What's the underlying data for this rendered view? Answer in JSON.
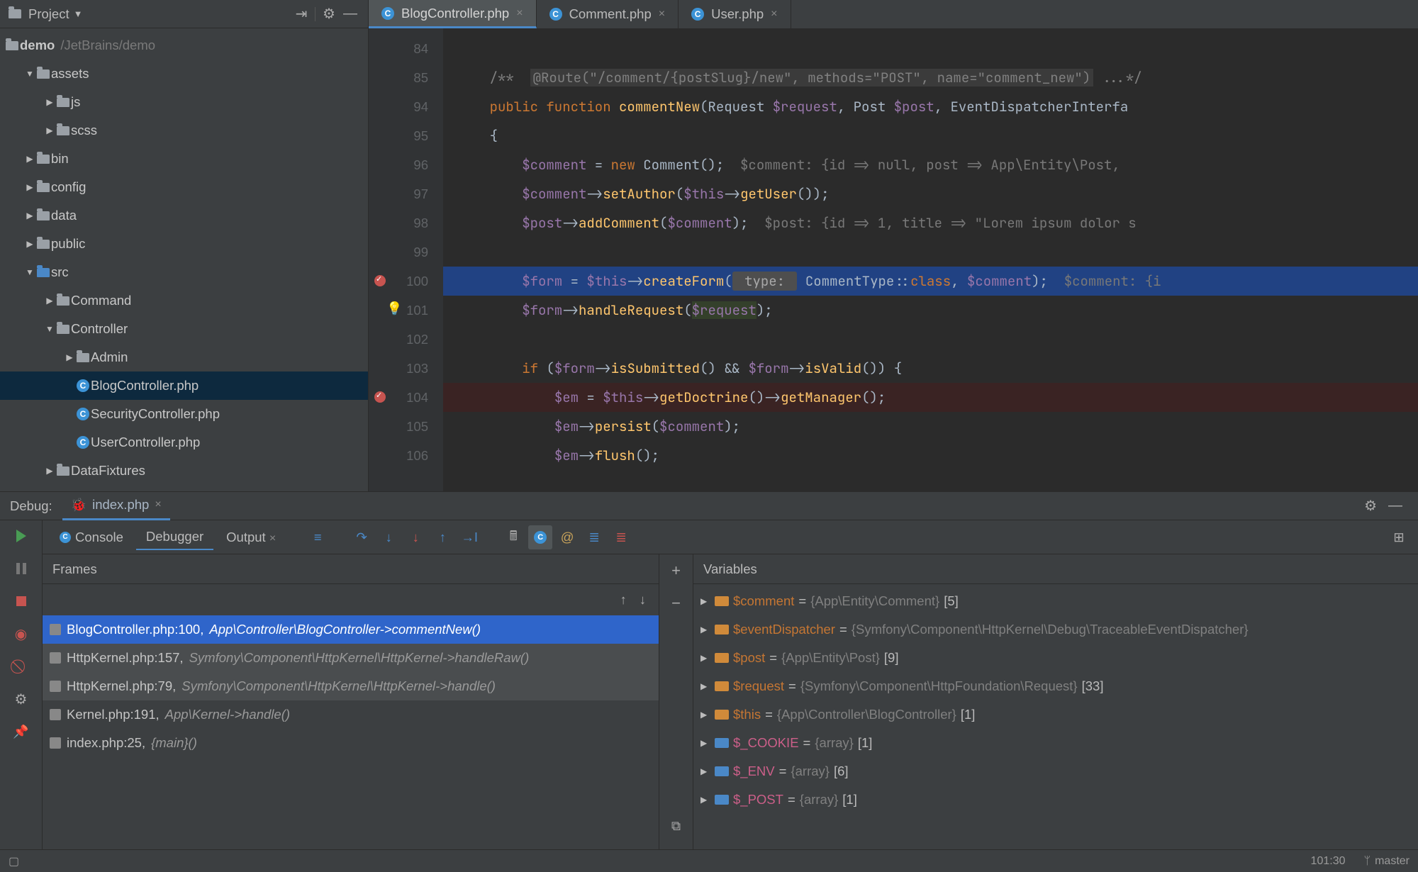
{
  "sidebar": {
    "header": {
      "label": "Project"
    },
    "root": {
      "name": "demo",
      "path": "/JetBrains/demo"
    },
    "items": [
      {
        "label": "assets",
        "kind": "folder",
        "indent": 1,
        "open": true
      },
      {
        "label": "js",
        "kind": "folder",
        "indent": 2
      },
      {
        "label": "scss",
        "kind": "folder",
        "indent": 2
      },
      {
        "label": "bin",
        "kind": "folder",
        "indent": 1
      },
      {
        "label": "config",
        "kind": "folder",
        "indent": 1
      },
      {
        "label": "data",
        "kind": "folder",
        "indent": 1
      },
      {
        "label": "public",
        "kind": "folder",
        "indent": 1
      },
      {
        "label": "src",
        "kind": "folder-blue",
        "indent": 1,
        "open": true
      },
      {
        "label": "Command",
        "kind": "folder",
        "indent": 2
      },
      {
        "label": "Controller",
        "kind": "folder",
        "indent": 2,
        "open": true
      },
      {
        "label": "Admin",
        "kind": "folder",
        "indent": 3
      },
      {
        "label": "BlogController.php",
        "kind": "php",
        "indent": 3,
        "selected": true
      },
      {
        "label": "SecurityController.php",
        "kind": "php",
        "indent": 3
      },
      {
        "label": "UserController.php",
        "kind": "php",
        "indent": 3
      },
      {
        "label": "DataFixtures",
        "kind": "folder",
        "indent": 2
      }
    ]
  },
  "tabs": [
    {
      "label": "BlogController.php",
      "active": true
    },
    {
      "label": "Comment.php"
    },
    {
      "label": "User.php"
    }
  ],
  "editor": {
    "gutter": [
      "84",
      "85",
      "94",
      "95",
      "96",
      "97",
      "98",
      "99",
      "100",
      "101",
      "102",
      "103",
      "104",
      "105",
      "106"
    ],
    "breakpoints": {
      "100": true,
      "104": true
    },
    "execLine": "100",
    "bulbLine": "101"
  },
  "debug": {
    "title": "Debug:",
    "session": "index.php",
    "toolTabs": {
      "console": "Console",
      "debugger": "Debugger",
      "output": "Output"
    },
    "framesTitle": "Frames",
    "varsTitle": "Variables",
    "frames": [
      {
        "file": "BlogController.php",
        "line": "100",
        "ctx": "App\\Controller\\BlogController->commentNew()",
        "sel": true
      },
      {
        "file": "HttpKernel.php",
        "line": "157",
        "ctx": "Symfony\\Component\\HttpKernel\\HttpKernel->handleRaw()",
        "dim": true
      },
      {
        "file": "HttpKernel.php",
        "line": "79",
        "ctx": "Symfony\\Component\\HttpKernel\\HttpKernel->handle()",
        "dim": true
      },
      {
        "file": "Kernel.php",
        "line": "191",
        "ctx": "App\\Kernel->handle()"
      },
      {
        "file": "index.php",
        "line": "25",
        "ctx": "{main}()"
      }
    ],
    "vars": [
      {
        "name": "$comment",
        "val": "{App\\Entity\\Comment}",
        "count": "[5]",
        "kind": "obj"
      },
      {
        "name": "$eventDispatcher",
        "val": "{Symfony\\Component\\HttpKernel\\Debug\\TraceableEventDispatcher}",
        "count": "",
        "kind": "obj"
      },
      {
        "name": "$post",
        "val": "{App\\Entity\\Post}",
        "count": "[9]",
        "kind": "obj"
      },
      {
        "name": "$request",
        "val": "{Symfony\\Component\\HttpFoundation\\Request}",
        "count": "[33]",
        "kind": "obj"
      },
      {
        "name": "$this",
        "val": "{App\\Controller\\BlogController}",
        "count": "[1]",
        "kind": "obj"
      },
      {
        "name": "$_COOKIE",
        "val": "{array}",
        "count": "[1]",
        "kind": "arr",
        "super": true
      },
      {
        "name": "$_ENV",
        "val": "{array}",
        "count": "[6]",
        "kind": "arr",
        "super": true
      },
      {
        "name": "$_POST",
        "val": "{array}",
        "count": "[1]",
        "kind": "arr",
        "super": true
      }
    ]
  },
  "status": {
    "pos": "101:30",
    "branch": "master"
  }
}
